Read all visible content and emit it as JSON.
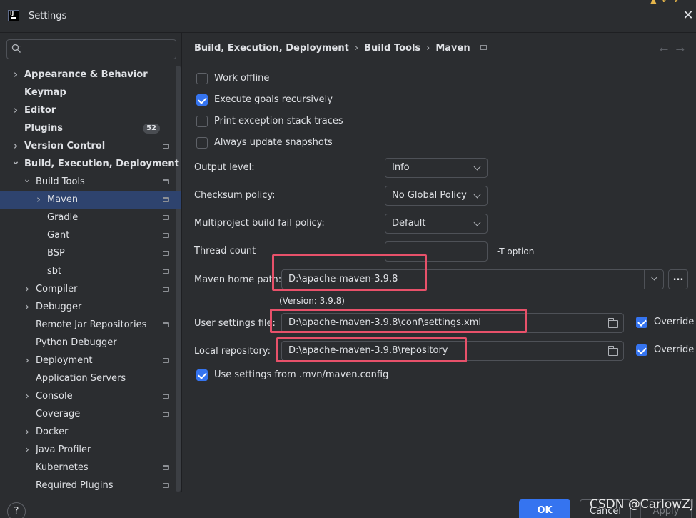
{
  "window": {
    "title": "Settings",
    "logo_text": "IJ"
  },
  "search": {
    "value": "",
    "placeholder": ""
  },
  "sidebar": {
    "items": [
      {
        "label": "Appearance & Behavior",
        "level": 0,
        "expandable": true,
        "expanded": false,
        "bold": true,
        "pin": false
      },
      {
        "label": "Keymap",
        "level": 0,
        "expandable": false,
        "bold": true,
        "pin": false
      },
      {
        "label": "Editor",
        "level": 0,
        "expandable": true,
        "expanded": false,
        "bold": true,
        "pin": false
      },
      {
        "label": "Plugins",
        "level": 0,
        "expandable": false,
        "bold": true,
        "pin": false,
        "badge": "52"
      },
      {
        "label": "Version Control",
        "level": 0,
        "expandable": true,
        "expanded": false,
        "bold": true,
        "pin": true
      },
      {
        "label": "Build, Execution, Deployment",
        "level": 0,
        "expandable": true,
        "expanded": true,
        "bold": true,
        "pin": false
      },
      {
        "label": "Build Tools",
        "level": 1,
        "expandable": true,
        "expanded": true,
        "pin": true
      },
      {
        "label": "Maven",
        "level": 2,
        "expandable": true,
        "expanded": false,
        "pin": true,
        "selected": true
      },
      {
        "label": "Gradle",
        "level": 2,
        "expandable": false,
        "pin": true
      },
      {
        "label": "Gant",
        "level": 2,
        "expandable": false,
        "pin": true
      },
      {
        "label": "BSP",
        "level": 2,
        "expandable": false,
        "pin": true
      },
      {
        "label": "sbt",
        "level": 2,
        "expandable": false,
        "pin": true
      },
      {
        "label": "Compiler",
        "level": 1,
        "expandable": true,
        "expanded": false,
        "pin": true
      },
      {
        "label": "Debugger",
        "level": 1,
        "expandable": true,
        "expanded": false,
        "pin": false
      },
      {
        "label": "Remote Jar Repositories",
        "level": 1,
        "expandable": false,
        "pin": true
      },
      {
        "label": "Python Debugger",
        "level": 1,
        "expandable": false,
        "pin": false
      },
      {
        "label": "Deployment",
        "level": 1,
        "expandable": true,
        "expanded": false,
        "pin": true
      },
      {
        "label": "Application Servers",
        "level": 1,
        "expandable": false,
        "pin": false
      },
      {
        "label": "Console",
        "level": 1,
        "expandable": true,
        "expanded": false,
        "pin": true
      },
      {
        "label": "Coverage",
        "level": 1,
        "expandable": false,
        "pin": true
      },
      {
        "label": "Docker",
        "level": 1,
        "expandable": true,
        "expanded": false,
        "pin": false
      },
      {
        "label": "Java Profiler",
        "level": 1,
        "expandable": true,
        "expanded": false,
        "pin": false
      },
      {
        "label": "Kubernetes",
        "level": 1,
        "expandable": false,
        "pin": true
      },
      {
        "label": "Required Plugins",
        "level": 1,
        "expandable": false,
        "pin": true
      }
    ]
  },
  "breadcrumb": [
    "Build, Execution, Deployment",
    "Build Tools",
    "Maven"
  ],
  "maven": {
    "checkboxes": [
      {
        "label": "Work offline",
        "checked": false
      },
      {
        "label": "Execute goals recursively",
        "checked": true
      },
      {
        "label": "Print exception stack traces",
        "checked": false
      },
      {
        "label": "Always update snapshots",
        "checked": false
      }
    ],
    "output_level": {
      "label": "Output level:",
      "value": "Info"
    },
    "checksum_policy": {
      "label": "Checksum policy:",
      "value": "No Global Policy"
    },
    "fail_policy": {
      "label": "Multiproject build fail policy:",
      "value": "Default"
    },
    "thread_count": {
      "label": "Thread count",
      "value": "",
      "hint": "-T option"
    },
    "home_path": {
      "label": "Maven home path:",
      "value": "D:\\apache-maven-3.9.8",
      "version": "(Version: 3.9.8)",
      "more_label": "..."
    },
    "user_settings": {
      "label": "User settings file:",
      "value": "D:\\apache-maven-3.9.8\\conf\\settings.xml",
      "override_label": "Override",
      "override": true
    },
    "local_repo": {
      "label": "Local repository:",
      "value": "D:\\apache-maven-3.9.8\\repository",
      "override_label": "Override",
      "override": true
    },
    "mvn_config": {
      "label": "Use settings from .mvn/maven.config",
      "checked": true
    }
  },
  "footer": {
    "help_label": "?",
    "ok_label": "OK",
    "cancel_label": "Cancel",
    "apply_label": "Apply"
  },
  "watermark": "CSDN @CarlowZJ",
  "colors": {
    "background": "#2b2d30",
    "selection": "#2e436e",
    "accent": "#3574f0",
    "highlight_box": "#e8516a",
    "text": "#dfe1e5"
  }
}
